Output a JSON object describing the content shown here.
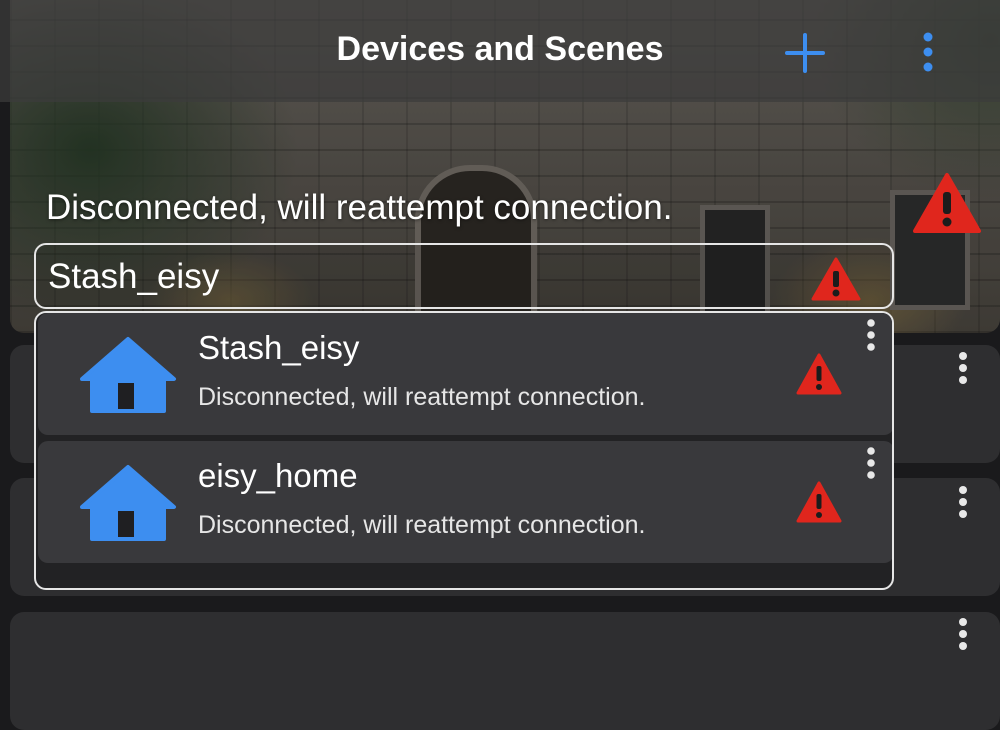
{
  "header": {
    "title": "Devices and Scenes",
    "add_icon": "plus-icon",
    "menu_icon": "vertical-ellipsis-icon",
    "accent_color": "#3d8ef0"
  },
  "hero": {
    "status_text": "Disconnected, will reattempt connection.",
    "status_icon": "warning-triangle-icon",
    "warning_color": "#e0261d"
  },
  "selector": {
    "selected_value": "Stash_eisy",
    "status_icon": "warning-triangle-icon"
  },
  "dropdown": {
    "items": [
      {
        "name": "Stash_eisy",
        "status": "Disconnected, will reattempt connection.",
        "icon": "home-icon",
        "status_icon": "warning-triangle-icon"
      },
      {
        "name": "eisy_home",
        "status": "Disconnected, will reattempt connection.",
        "icon": "home-icon",
        "status_icon": "warning-triangle-icon"
      }
    ]
  }
}
